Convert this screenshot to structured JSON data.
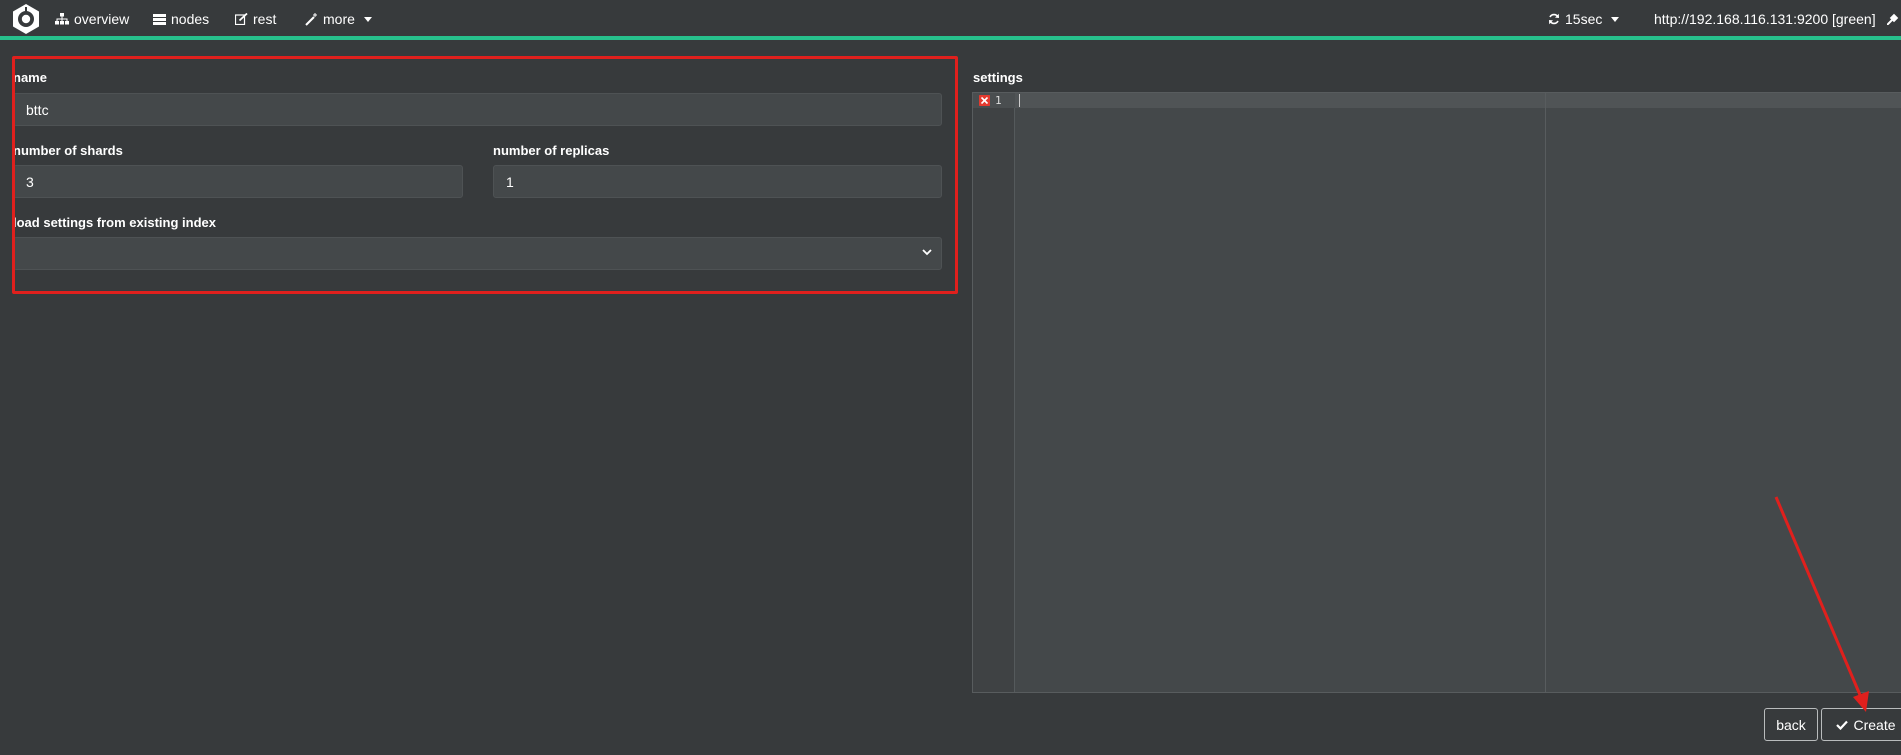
{
  "nav": {
    "overview": "overview",
    "nodes": "nodes",
    "rest": "rest",
    "more": "more",
    "refresh": "15sec",
    "cluster_url": "http://192.168.116.131:9200 [green]"
  },
  "form": {
    "name_label": "name",
    "name_value": "bttc",
    "shards_label": "number of shards",
    "shards_value": "3",
    "replicas_label": "number of replicas",
    "replicas_value": "1",
    "load_settings_label": "load settings from existing index",
    "load_settings_value": ""
  },
  "settings": {
    "label": "settings",
    "line_number": "1"
  },
  "actions": {
    "back_label": "back",
    "create_label": "Create"
  },
  "colors": {
    "accent": "#27c08c",
    "annotation": "#e0201d",
    "background": "#373a3c"
  }
}
